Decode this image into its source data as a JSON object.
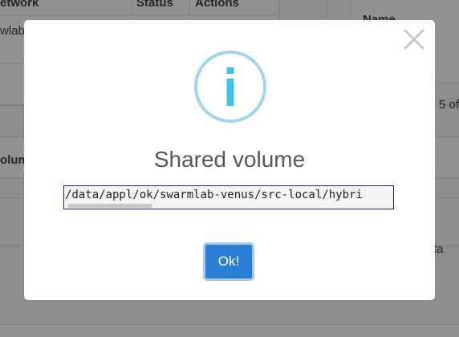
{
  "background": {
    "table_headers": {
      "network": "etwork",
      "status": "Status",
      "actions": "Actions",
      "name": "Name"
    },
    "cell_network_value": "wlabo",
    "section_label": "olum",
    "pagination_text": "5 of",
    "side_text": "ta"
  },
  "dialog": {
    "icon": "info-icon",
    "title": "Shared volume",
    "path_value": "/data/appl/ok/swarmlab-venus/src-local/hybri",
    "ok_label": "Ok!",
    "close_label": "×"
  },
  "colors": {
    "accent": "#2b7cd3",
    "info_icon": "#9fd6ee",
    "overlay": "rgba(0,0,0,0.4)"
  }
}
